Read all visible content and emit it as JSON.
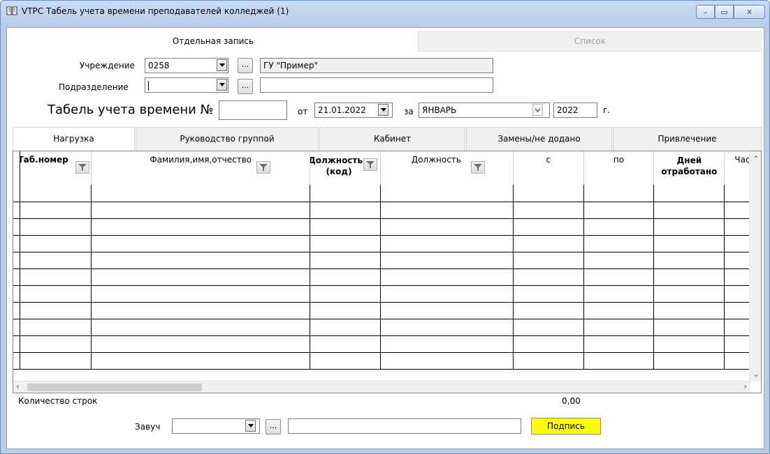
{
  "window": {
    "title": "VTPC Табель учета времени преподавателей колледжей (1)",
    "minimize": "–",
    "maximize": "▭",
    "close": "✕"
  },
  "page_tabs": [
    "Отдельная запись",
    "Список"
  ],
  "form": {
    "institution_label": "Учреждение",
    "institution_code": "0258",
    "institution_name": "ГУ \"Пример\"",
    "subdivision_label": "Подразделение",
    "subdivision_code": "",
    "subdivision_name": "",
    "timesheet_label": "Табель учета времени №",
    "timesheet_number": "",
    "from_label": "от",
    "date": "21.01.2022",
    "for_label": "за",
    "month": "ЯНВАРЬ",
    "year": "2022",
    "year_suffix": "г.",
    "dots": "..."
  },
  "inner_tabs": [
    "Нагрузка",
    "Руководство группой",
    "Кабинет",
    "Замены/не додано",
    "Привлечение"
  ],
  "grid": {
    "columns": [
      {
        "label": "Таб.номер",
        "bold": true
      },
      {
        "label": "Фамилия,имя,отчество",
        "bold": false
      },
      {
        "label": "Должность (код)",
        "bold": true
      },
      {
        "label": "Должность",
        "bold": false
      },
      {
        "label": "с",
        "bold": false
      },
      {
        "label": "по",
        "bold": false
      },
      {
        "label": "Дней отработано",
        "bold": true
      },
      {
        "label": "Часов",
        "bold": false
      }
    ],
    "col_header_lines": {
      "tab": "Таб.номер",
      "fio": "Фамилия,имя,отчество",
      "pos_code_1": "Должность",
      "pos_code_2": "(код)",
      "pos": "Должность",
      "from": "с",
      "to": "по",
      "days_1": "Дней",
      "days_2": "отработано",
      "hours": "Часов"
    },
    "row_count": 11
  },
  "footer": {
    "rows_label": "Количество строк",
    "total": "0,00",
    "deputy_label": "Завуч",
    "deputy_code": "",
    "deputy_name": "",
    "sign_button": "Подпись"
  },
  "colors": {
    "sign_button": "#ffff00"
  }
}
